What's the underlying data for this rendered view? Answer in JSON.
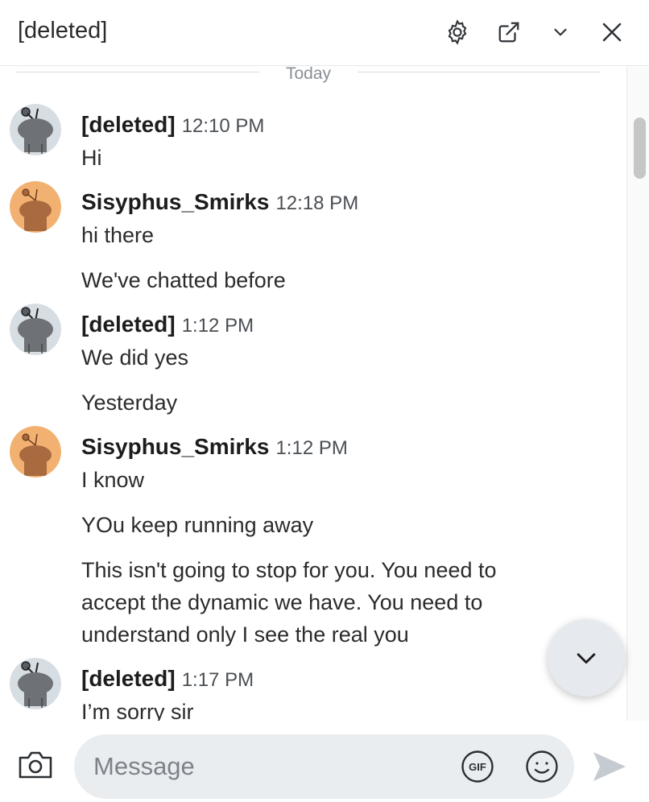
{
  "header": {
    "title": "[deleted]",
    "icons": [
      "gear-icon",
      "external-link-icon",
      "chevron-down-icon",
      "close-icon"
    ]
  },
  "divider": {
    "label": "Today"
  },
  "messages": [
    {
      "author": "[deleted]",
      "time": "12:10 PM",
      "avatar": "snoo-gray",
      "lines": [
        "Hi"
      ]
    },
    {
      "author": "Sisyphus_Smirks",
      "time": "12:18 PM",
      "avatar": "snoo-orange",
      "lines": [
        "hi there",
        "We've chatted before"
      ]
    },
    {
      "author": "[deleted]",
      "time": "1:12 PM",
      "avatar": "snoo-gray",
      "lines": [
        "We did yes",
        "Yesterday"
      ]
    },
    {
      "author": "Sisyphus_Smirks",
      "time": "1:12 PM",
      "avatar": "snoo-orange",
      "lines": [
        "I know",
        "YOu keep running away",
        "This isn't going to stop for you. You need to accept the dynamic we have. You need to understand only I see the real you"
      ]
    },
    {
      "author": "[deleted]",
      "time": "1:17 PM",
      "avatar": "snoo-gray",
      "lines": [
        "I’m sorry sir"
      ]
    }
  ],
  "composer": {
    "placeholder": "Message",
    "gif_label": "GIF",
    "icons": [
      "camera-icon",
      "gif-icon",
      "emoji-icon",
      "send-icon"
    ]
  },
  "colors": {
    "avatar_gray_bg": "#d6dde3",
    "avatar_orange_bg": "#f2b170",
    "input_bg": "#eaedf0",
    "send_disabled": "#c5cbd0"
  }
}
